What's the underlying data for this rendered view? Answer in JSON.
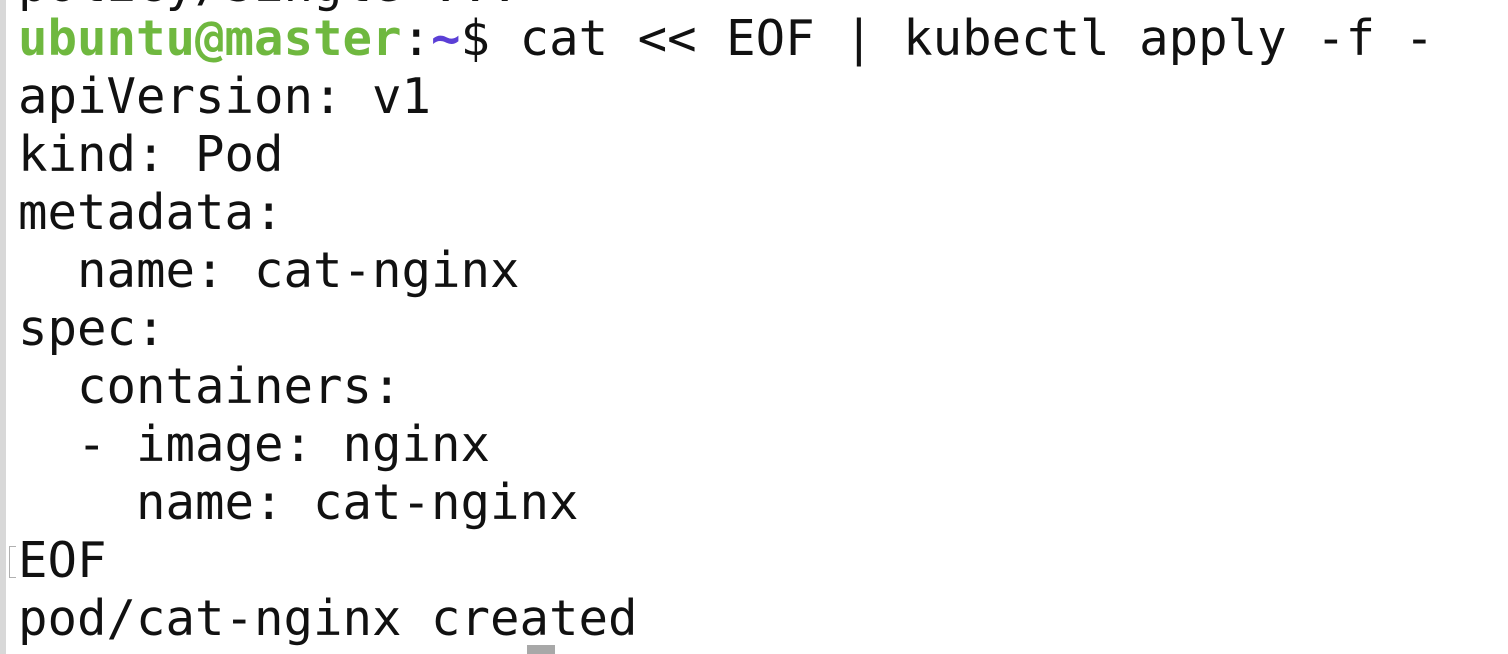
{
  "terminal": {
    "partial_top_line": "policy/single-...",
    "prompt": {
      "user_host": "ubuntu@master",
      "colon": ":",
      "path": "~",
      "dollar": "$",
      "command": " cat << EOF | kubectl apply -f -"
    },
    "lines": [
      "apiVersion: v1",
      "kind: Pod",
      "metadata:",
      "  name: cat-nginx",
      "spec:",
      "  containers:",
      "  - image: nginx",
      "    name: cat-nginx",
      "EOF",
      "pod/cat-nginx created"
    ]
  },
  "colors": {
    "user_host": "#6fb83f",
    "path": "#5b3fd6",
    "text": "#111111",
    "background": "#ffffff"
  }
}
